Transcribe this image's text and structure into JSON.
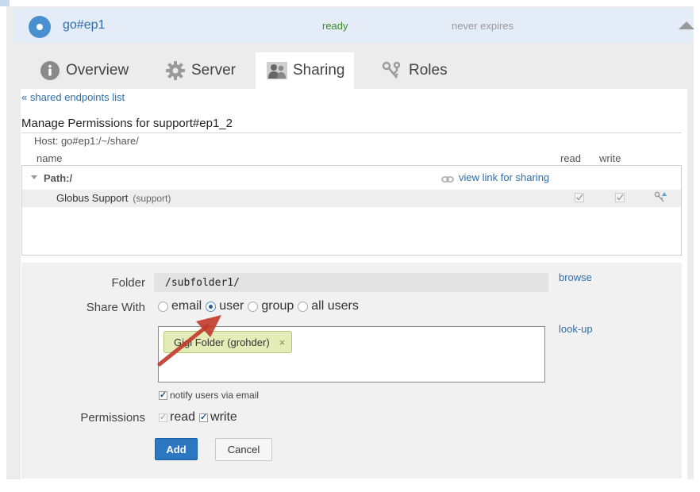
{
  "endpoint": {
    "name": "go#ep1",
    "status": "ready",
    "expiry": "never expires"
  },
  "tabs": [
    {
      "label": "Overview",
      "icon": "info-icon"
    },
    {
      "label": "Server",
      "icon": "gear-icon"
    },
    {
      "label": "Sharing",
      "icon": "users-icon",
      "active": true
    },
    {
      "label": "Roles",
      "icon": "keys-icon"
    }
  ],
  "sharing": {
    "back_link": "« shared endpoints list",
    "title": "Manage Permissions for support#ep1_2",
    "host": "Host: go#ep1:/~/share/",
    "columns": {
      "name": "name",
      "read": "read",
      "write": "write"
    },
    "path_label": "Path:/",
    "view_link": "view link for sharing",
    "rows": [
      {
        "name": "Globus Support",
        "handle": "(support)",
        "read": true,
        "write": true
      }
    ]
  },
  "form": {
    "folder_label": "Folder",
    "folder_value": "/subfolder1/",
    "browse": "browse",
    "share_with_label": "Share With",
    "share_options": [
      "email",
      "user",
      "group",
      "all users"
    ],
    "share_selected": "user",
    "lookup": "look-up",
    "selected_user": "Gigi Folder (grohder)",
    "token_remove": "×",
    "notify_label": "notify users via email",
    "permissions_label": "Permissions",
    "perm_read": "read",
    "perm_write": "write",
    "add_button": "Add",
    "cancel_button": "Cancel"
  },
  "colors": {
    "link": "#2f6ea8",
    "ready": "#3a8a2a",
    "primary_button": "#2b77c2",
    "annotation_arrow": "#c0392b"
  }
}
